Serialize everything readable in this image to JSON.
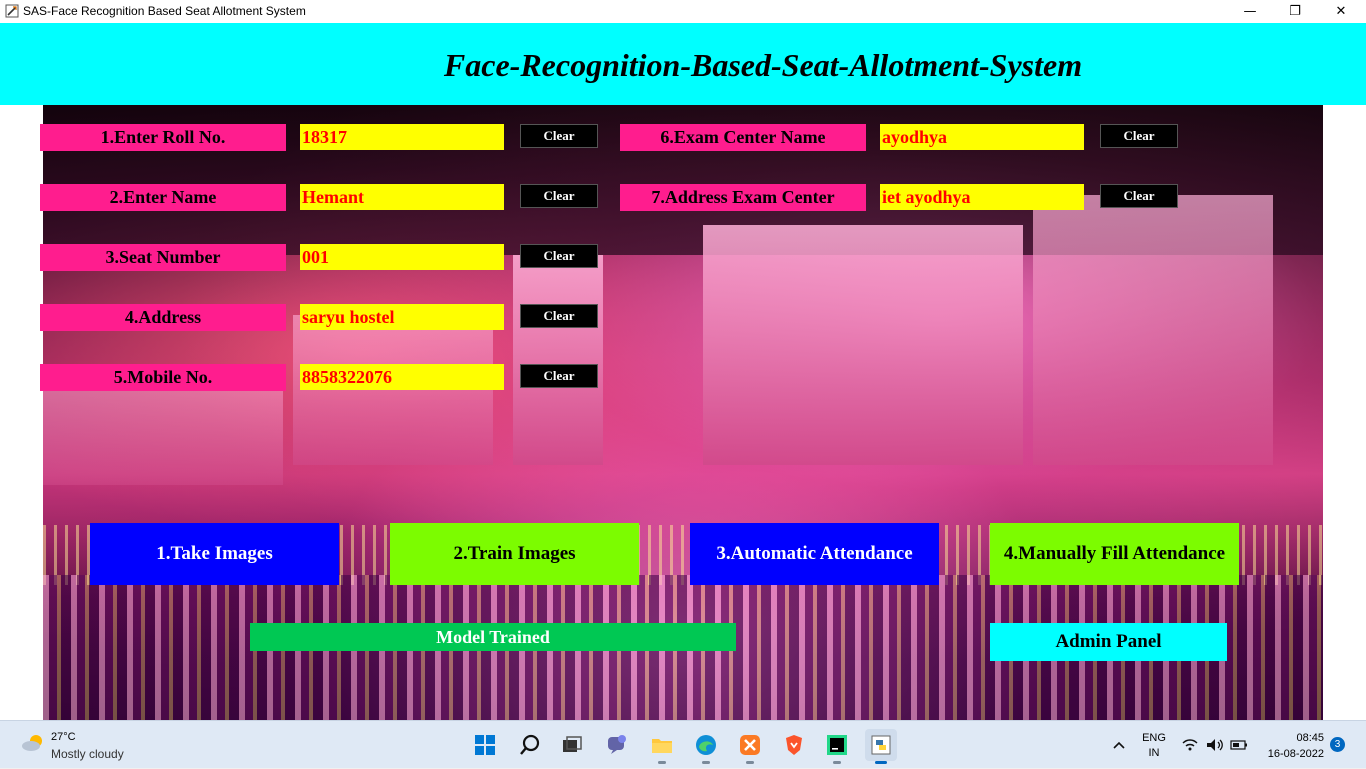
{
  "window": {
    "title": "SAS-Face Recognition Based Seat Allotment System",
    "minimize_glyph": "—",
    "restore_glyph": "❐",
    "close_glyph": "✕"
  },
  "header": {
    "title": "Face-Recognition-Based-Seat-Allotment-System"
  },
  "form": {
    "clear_label": "Clear",
    "left_fields": [
      {
        "label": "1.Enter Roll No.",
        "value": "18317"
      },
      {
        "label": "2.Enter Name",
        "value": "Hemant"
      },
      {
        "label": "3.Seat Number",
        "value": "001"
      },
      {
        "label": "4.Address",
        "value": "saryu hostel"
      },
      {
        "label": "5.Mobile No.",
        "value": "8858322076"
      }
    ],
    "right_fields": [
      {
        "label": "6.Exam Center Name",
        "value": "ayodhya"
      },
      {
        "label": "7.Address Exam Center",
        "value": "iet ayodhya"
      }
    ]
  },
  "actions": {
    "take_images": "1.Take Images",
    "train_images": "2.Train Images",
    "automatic_attendance": "3.Automatic Attendance",
    "manual_attendance": "4.Manually Fill Attendance",
    "admin_panel": "Admin Panel"
  },
  "status": {
    "message": "Model Trained"
  },
  "colors": {
    "header_bg": "#00ffff",
    "label_bg": "#ff1d8e",
    "field_bg": "#ffff00",
    "field_text": "#ff0000",
    "take_images_bg": "#0000ff",
    "train_images_bg": "#7cfc00",
    "automatic_attendance_bg": "#0000ff",
    "manual_attendance_bg": "#7cfc00",
    "status_bg": "#00c853",
    "admin_bg": "#00ffff"
  },
  "taskbar": {
    "weather_temp": "27°C",
    "weather_condition": "Mostly cloudy",
    "apps": [
      "start-icon",
      "search-icon",
      "task-view-icon",
      "teams-chat-icon",
      "file-explorer-icon",
      "edge-icon",
      "xampp-icon",
      "brave-icon",
      "pycharm-icon",
      "python-icon"
    ],
    "lang_line1": "ENG",
    "lang_line2": "IN",
    "time": "08:45",
    "date": "16-08-2022",
    "notification_count": "3"
  }
}
